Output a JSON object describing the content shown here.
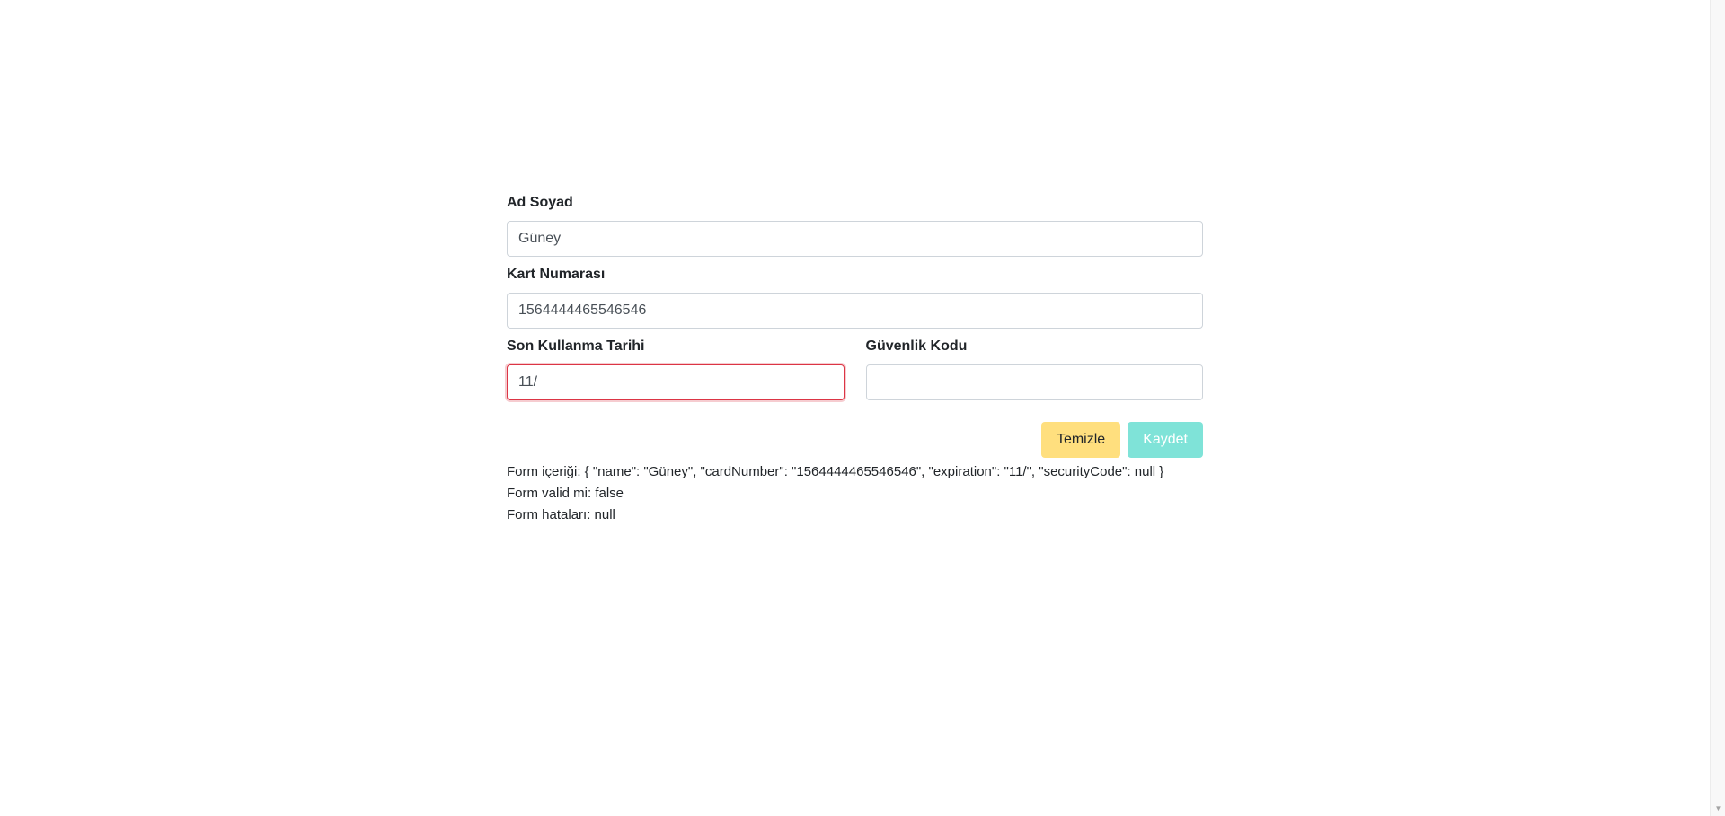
{
  "form": {
    "name": {
      "label": "Ad Soyad",
      "value": "Güney"
    },
    "card_number": {
      "label": "Kart Numarası",
      "value": "1564444465546546"
    },
    "expiration": {
      "label": "Son Kullanma Tarihi",
      "value": "11/"
    },
    "security_code": {
      "label": "Güvenlik Kodu",
      "value": ""
    },
    "buttons": {
      "clear_label": "Temizle",
      "save_label": "Kaydet"
    }
  },
  "output": {
    "content_line": "Form içeriği: { \"name\": \"Güney\", \"cardNumber\": \"1564444465546546\", \"expiration\": \"11/\", \"securityCode\": null }",
    "valid_line": "Form valid mi: false",
    "errors_line": "Form hataları: null"
  },
  "colors": {
    "clear_button": "#ffdf7e",
    "save_button_disabled": "#7fe3d8",
    "invalid_border": "#dc3545"
  },
  "icons": {
    "scroll_down": "chevron-down-icon"
  }
}
